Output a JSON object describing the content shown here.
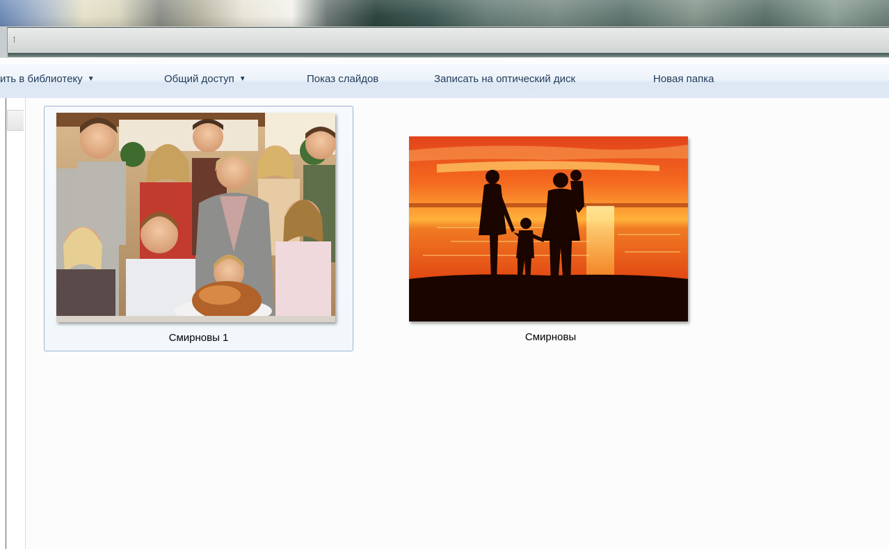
{
  "toolbar": {
    "items": [
      {
        "label": "ить в библиотеку",
        "has_dropdown": true
      },
      {
        "label": "Общий доступ",
        "has_dropdown": true
      },
      {
        "label": "Показ слайдов",
        "has_dropdown": false
      },
      {
        "label": "Записать на оптический диск",
        "has_dropdown": false
      },
      {
        "label": "Новая папка",
        "has_dropdown": false
      }
    ],
    "dropdown_glyph": "▼"
  },
  "files": [
    {
      "name": "Смирновы 1",
      "thumbnail": "family-group-photo",
      "selected": true
    },
    {
      "name": "Смирновы",
      "thumbnail": "sunset-silhouette-photo",
      "selected": false
    }
  ],
  "colors": {
    "command_text": "#1e395b",
    "selection_border": "#99b4d1",
    "content_background": "#fcfcfc"
  }
}
